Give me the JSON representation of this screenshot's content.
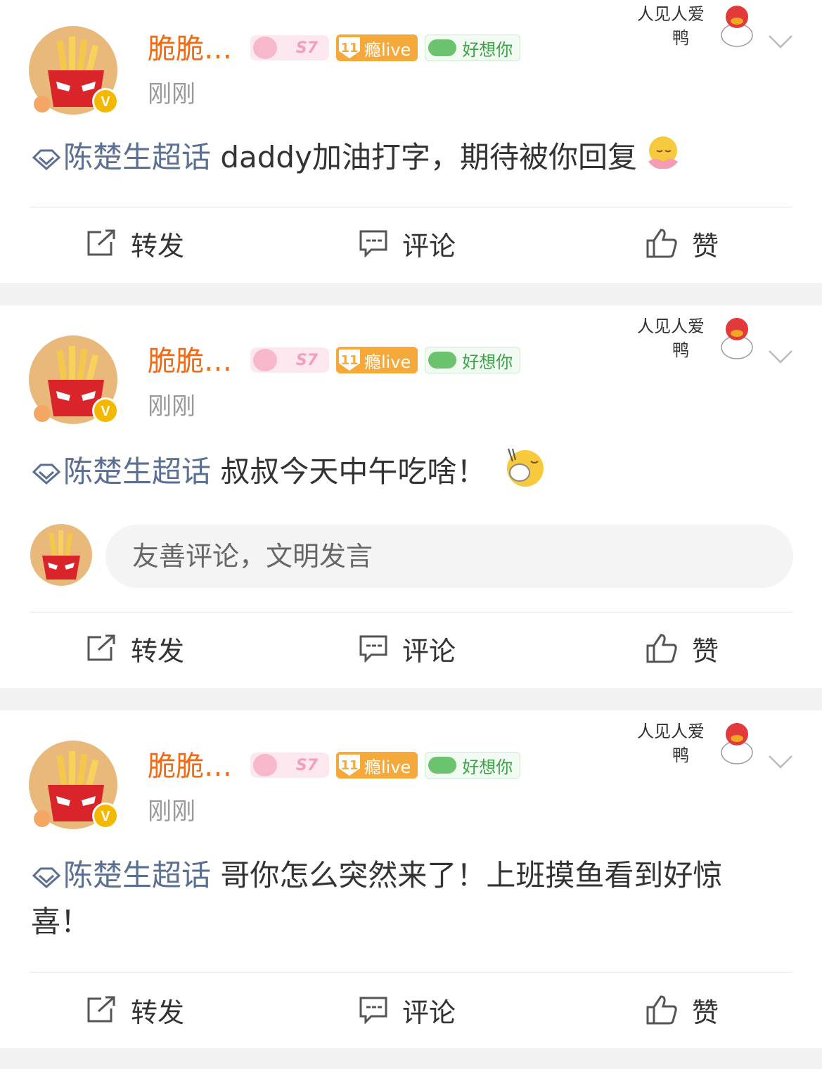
{
  "posts": [
    {
      "username": "脆脆…",
      "level_badge": "S7",
      "live_badge_num": "11",
      "live_badge_text": "瘾live",
      "miss_badge_text": "好想你",
      "time": "刚刚",
      "decoration_line1": "人见人爱",
      "decoration_line2": "鸭",
      "topic": "陈楚生超话",
      "text": "daddy加油打字，期待被你回复",
      "repost_label": "转发",
      "comment_label": "评论",
      "like_label": "赞"
    },
    {
      "username": "脆脆…",
      "level_badge": "S7",
      "live_badge_num": "11",
      "live_badge_text": "瘾live",
      "miss_badge_text": "好想你",
      "time": "刚刚",
      "decoration_line1": "人见人爱",
      "decoration_line2": "鸭",
      "topic": "陈楚生超话",
      "text": "叔叔今天中午吃啥！",
      "comment_placeholder": "友善评论，文明发言",
      "repost_label": "转发",
      "comment_label": "评论",
      "like_label": "赞"
    },
    {
      "username": "脆脆…",
      "level_badge": "S7",
      "live_badge_num": "11",
      "live_badge_text": "瘾live",
      "miss_badge_text": "好想你",
      "time": "刚刚",
      "decoration_line1": "人见人爱",
      "decoration_line2": "鸭",
      "topic": "陈楚生超话",
      "text": "哥你怎么突然来了！上班摸鱼看到好惊喜！",
      "repost_label": "转发",
      "comment_label": "评论",
      "like_label": "赞"
    }
  ],
  "colors": {
    "username": "#f26a11",
    "topic": "#5b6f93",
    "verified": "#f5b800",
    "background": "#f2f2f2"
  }
}
